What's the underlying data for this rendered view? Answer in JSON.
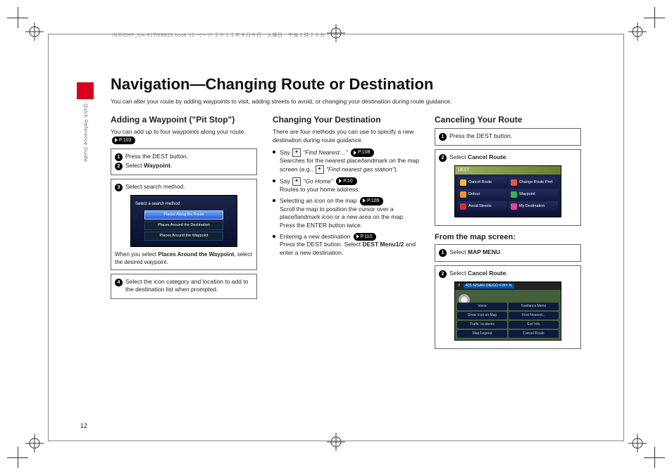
{
  "meta": {
    "header_line": "INSIGHT_KA-31TM8820.book  12 ページ  ２０１１年８月９日　火曜日　午後１時２６分",
    "sidebar_label": "Quick Reference Guide",
    "page_number": "12"
  },
  "title": "Navigation—Changing Route or Destination",
  "intro": "You can alter your route by adding waypoints to visit, adding streets to avoid, or changing your destination during route guidance.",
  "col1": {
    "heading": "Adding a Waypoint (\"Pit Stop\")",
    "lead_a": "You can add up to four waypoints along your route.",
    "ref1": "P.103",
    "step1": "Press the DEST button.",
    "step2a": "Select ",
    "step2b": "Waypoint",
    "step2c": ".",
    "step3": "Select search method.",
    "ss_title": "Select a search method",
    "ss_opt1": "Places Along the Route",
    "ss_opt2": "Places Around the Destination",
    "ss_opt3": "Places Around the Waypoint",
    "caption_a": "When you select ",
    "caption_b": "Places Around the Waypoint",
    "caption_c": ", select the desired waypoint.",
    "step4": "Select the icon category and location to add to the destination list when prompted."
  },
  "col2": {
    "heading": "Changing Your Destination",
    "lead": "There are four methods you can use to specify a new destination during route guidance.",
    "b1_a": "Say ",
    "b1_icon": "⯑",
    "b1_b": "\"Find Nearest…\"",
    "b1_ref": "P.108",
    "b1_c": "Searches for the nearest place/landmark on the map screen (e.g., ",
    "b1_d": "\"Find nearest gas station\"",
    "b1_e": ").",
    "b2_a": "Say ",
    "b2_b": "\"Go Home\"",
    "b2_ref": "P.10",
    "b2_c": "Routes to your home address.",
    "b3_a": "Selecting an icon on the map",
    "b3_ref": "P.109",
    "b3_b": "Scroll the map to position the cursor over a place/landmark icon or a new area on the map. Press the ENTER button twice.",
    "b4_a": "Entering a new destination",
    "b4_ref": "P.110",
    "b4_b": "Press the DEST button. Select ",
    "b4_c": "DEST Menu1/2",
    "b4_d": " and enter a new destination."
  },
  "col3": {
    "heading1": "Canceling Your Route",
    "step1": "Press the DEST button.",
    "step2a": "Select ",
    "step2b": "Cancel Route",
    "step2c": ".",
    "ss1": {
      "tab": "DEST",
      "btn1": "Cancel Route",
      "btn2": "Change Route Pref.",
      "btn3": "Detour",
      "btn4": "Waypoint",
      "btn5": "Avoid Streets",
      "btn6": "My Destination"
    },
    "heading2": "From the map screen:",
    "step3a": "Select ",
    "step3b": "MAP MENU",
    "step3c": ".",
    "step4a": "Select ",
    "step4b": "Cancel Route",
    "step4c": ".",
    "ss2": {
      "addr": "405 N/SAN DIEGO FWY N",
      "m1": "Voice",
      "m2": "Guidance Menu",
      "m3": "Show Icon on Map",
      "m4": "Find Nearest...",
      "m5": "Traffic Incidents",
      "m6": "Exit Info",
      "m7": "Map Legend",
      "m8": "Cancel Route"
    }
  }
}
